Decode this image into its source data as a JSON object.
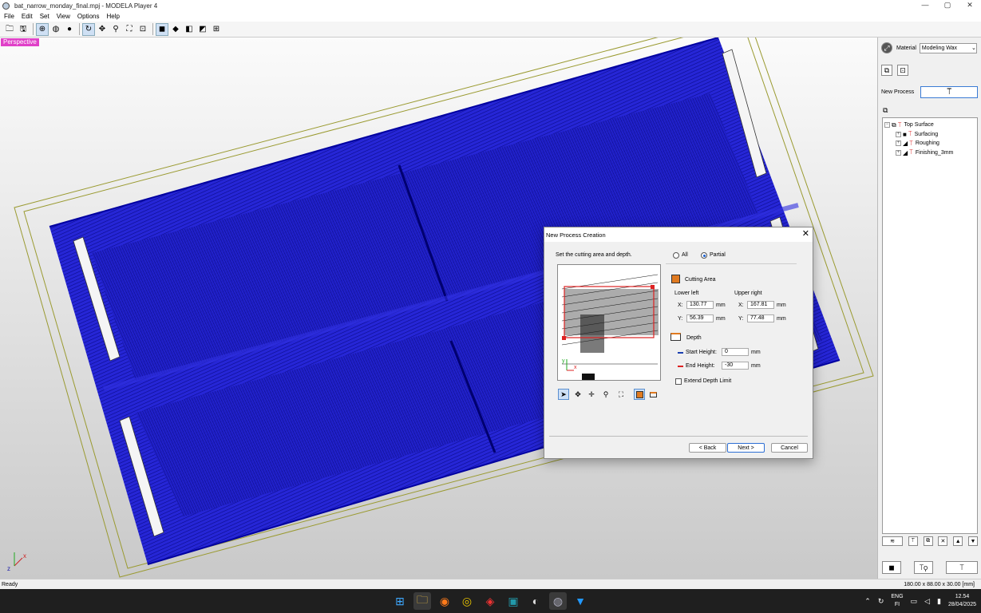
{
  "window": {
    "title": "bat_narrow_monday_final.mpj - MODELA Player 4",
    "controls": [
      "—",
      "▢",
      "✕"
    ]
  },
  "menu": [
    "File",
    "Edit",
    "Set",
    "View",
    "Options",
    "Help"
  ],
  "toolbar_icons": [
    "open-folder-icon",
    "save-icon",
    "view-globe-icon",
    "view-wire-icon",
    "view-sphere-icon",
    "rotate-icon",
    "pan-icon",
    "zoom-icon",
    "fit-icon",
    "zoom-window-icon",
    "cube-front-icon",
    "cube-top-icon",
    "cube-side-icon",
    "cube-iso-icon",
    "multi-view-icon"
  ],
  "viewport": {
    "label": "Perspective",
    "axis_x": "x",
    "axis_z": "z"
  },
  "right_panel": {
    "material_label": "Material",
    "material_value": "Modeling Wax",
    "new_process_label": "New Process",
    "tree": [
      {
        "label": "Top Surface",
        "level": 0
      },
      {
        "label": "Surfacing",
        "level": 1
      },
      {
        "label": "Roughing",
        "level": 1
      },
      {
        "label": "Finishing_3mm",
        "level": 1
      }
    ]
  },
  "status": {
    "left": "Ready",
    "right": "180.00 x 88.00 x 30.00 [mm]"
  },
  "dialog": {
    "title": "New Process Creation",
    "instruction": "Set the cutting area and depth.",
    "option_all": "All",
    "option_partial": "Partial",
    "selected_option": "Partial",
    "cutting_area_label": "Cutting Area",
    "lower_left_label": "Lower left",
    "upper_right_label": "Upper right",
    "x_label": "X:",
    "y_label": "Y:",
    "unit": "mm",
    "lower_left_x": "130.77",
    "lower_left_y": "56.39",
    "upper_right_x": "167.81",
    "upper_right_y": "77.48",
    "depth_label": "Depth",
    "start_height_label": "Start Height:",
    "start_height_value": "0",
    "end_height_label": "End Height:",
    "end_height_value": "-30",
    "extend_depth_label": "Extend Depth Limit",
    "extend_depth_checked": false,
    "back_button": "< Back",
    "next_button": "Next >",
    "cancel_button": "Cancel",
    "preview_axis_y": "y",
    "preview_axis_x": "x"
  },
  "taskbar": {
    "tray": {
      "lang_line1": "ENG",
      "lang_line2": "FI",
      "time": "12.54",
      "date": "28/04/2025"
    }
  },
  "colors": {
    "toolpath": "#1a1acc",
    "magenta_label": "#e040c8",
    "accent": "#2d6fd4",
    "stock_outline": "#9a9a30"
  }
}
